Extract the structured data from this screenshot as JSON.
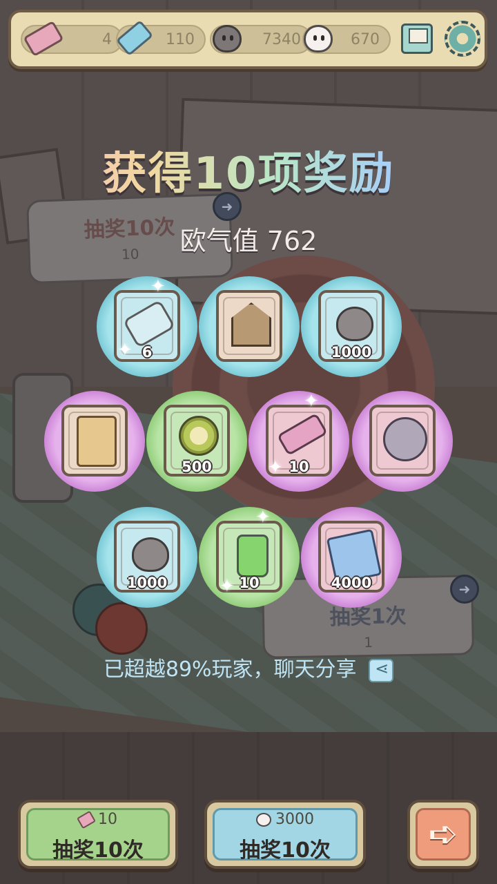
{
  "topbar": {
    "resources": [
      {
        "icon": "pink-ticket-icon",
        "value": "4"
      },
      {
        "icon": "blue-ticket-icon",
        "value": "110"
      },
      {
        "icon": "dark-ghost-icon",
        "value": "7340"
      },
      {
        "icon": "white-ghost-icon",
        "value": "670"
      }
    ],
    "mail_icon": "mail-icon",
    "settings_icon": "gear-icon"
  },
  "background": {
    "draw_ten": {
      "title": "抽奖10次",
      "cost": "10"
    },
    "draw_one": {
      "title": "抽奖1次",
      "cost": "1"
    }
  },
  "title": "获得10项奖励",
  "luck": "欧气值 762",
  "rewards": [
    {
      "item": "scroll",
      "rarity": "blue",
      "qty": "6"
    },
    {
      "item": "cuckoo-house",
      "rarity": "blue",
      "qty": ""
    },
    {
      "item": "gray-ghost",
      "rarity": "blue",
      "qty": "1000"
    },
    {
      "item": "parchment",
      "rarity": "purple",
      "qty": ""
    },
    {
      "item": "wheel",
      "rarity": "green",
      "qty": "500"
    },
    {
      "item": "telescope",
      "rarity": "purple",
      "qty": "10"
    },
    {
      "item": "portrait-coin",
      "rarity": "purple",
      "qty": ""
    },
    {
      "item": "gray-ghost",
      "rarity": "blue",
      "qty": "1000"
    },
    {
      "item": "potion-bottle",
      "rarity": "green",
      "qty": "10"
    },
    {
      "item": "embroidered-cloth",
      "rarity": "purple",
      "qty": "4000"
    }
  ],
  "share_text": "已超越89%玩家，聊天分享",
  "buttons": {
    "draw_ticket": {
      "cost": "10",
      "label": "抽奖10次"
    },
    "draw_ghost": {
      "cost": "3000",
      "label": "抽奖10次"
    },
    "next": "➪"
  },
  "colors": {
    "rarity_blue": "#7ccbd8",
    "rarity_purple": "#cf8ad9",
    "rarity_green": "#95d07e",
    "share_text": "#bfe4f4"
  }
}
